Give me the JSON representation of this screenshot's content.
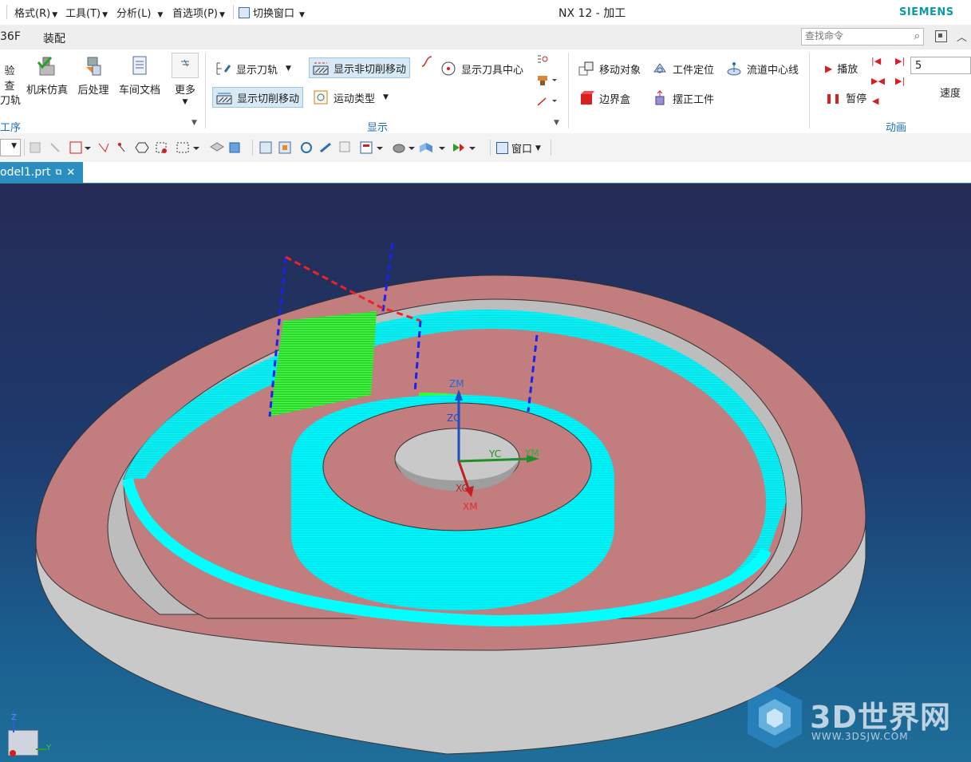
{
  "menubar": {
    "items": [
      {
        "label": "格式(R)"
      },
      {
        "label": "工具(T)"
      },
      {
        "label": "分析(L)"
      },
      {
        "label": "首选项(P)"
      },
      {
        "label": "切换窗口"
      }
    ],
    "app_title": "NX 12 - 加工",
    "brand": "SIEMENS"
  },
  "tabs": [
    {
      "label": "36F"
    },
    {
      "label": "装配"
    }
  ],
  "search": {
    "placeholder": "查找命令"
  },
  "ribbon": {
    "operation_group": {
      "label": "工序",
      "buttons": [
        {
          "label": "验查"
        },
        {
          "label": "刀轨"
        },
        {
          "label": "机床仿真"
        },
        {
          "label": "后处理"
        },
        {
          "label": "车间文档"
        },
        {
          "label": "更多"
        }
      ]
    },
    "display_group": {
      "label": "显示",
      "buttons": [
        {
          "label": "显示刀轨"
        },
        {
          "label": "显示非切削移动"
        },
        {
          "label": "显示刀具中心"
        },
        {
          "label": "显示切削移动"
        },
        {
          "label": "运动类型"
        }
      ]
    },
    "move_group": {
      "buttons": [
        {
          "label": "移动对象"
        },
        {
          "label": "工件定位"
        },
        {
          "label": "流道中心线"
        },
        {
          "label": "边界盒"
        },
        {
          "label": "摆正工件"
        }
      ]
    },
    "animation_group": {
      "label": "动画",
      "play_label": "播放",
      "pause_label": "暂停",
      "speed_value": "5",
      "speed_label": "速度"
    }
  },
  "toolbar2": {
    "window_label": "窗口"
  },
  "document": {
    "tab_label": "odel1.prt"
  },
  "viewport": {
    "axes": {
      "zm": "ZM",
      "zc": "ZC",
      "yc": "YC",
      "ym": "YM",
      "xc": "XC",
      "xm": "XM"
    },
    "triad": {
      "z": "Z",
      "y": "Y"
    },
    "colors": {
      "stock_side": "#c6c6c6",
      "stock_top": "#c58080",
      "toolpath": "#00ffff",
      "selected_path": "#33ff33",
      "non_cut": "#2222ff",
      "rapid": "#ff2222"
    }
  },
  "watermark": {
    "main": "3D世界网",
    "sub": "WWW.3DSJW.COM"
  }
}
